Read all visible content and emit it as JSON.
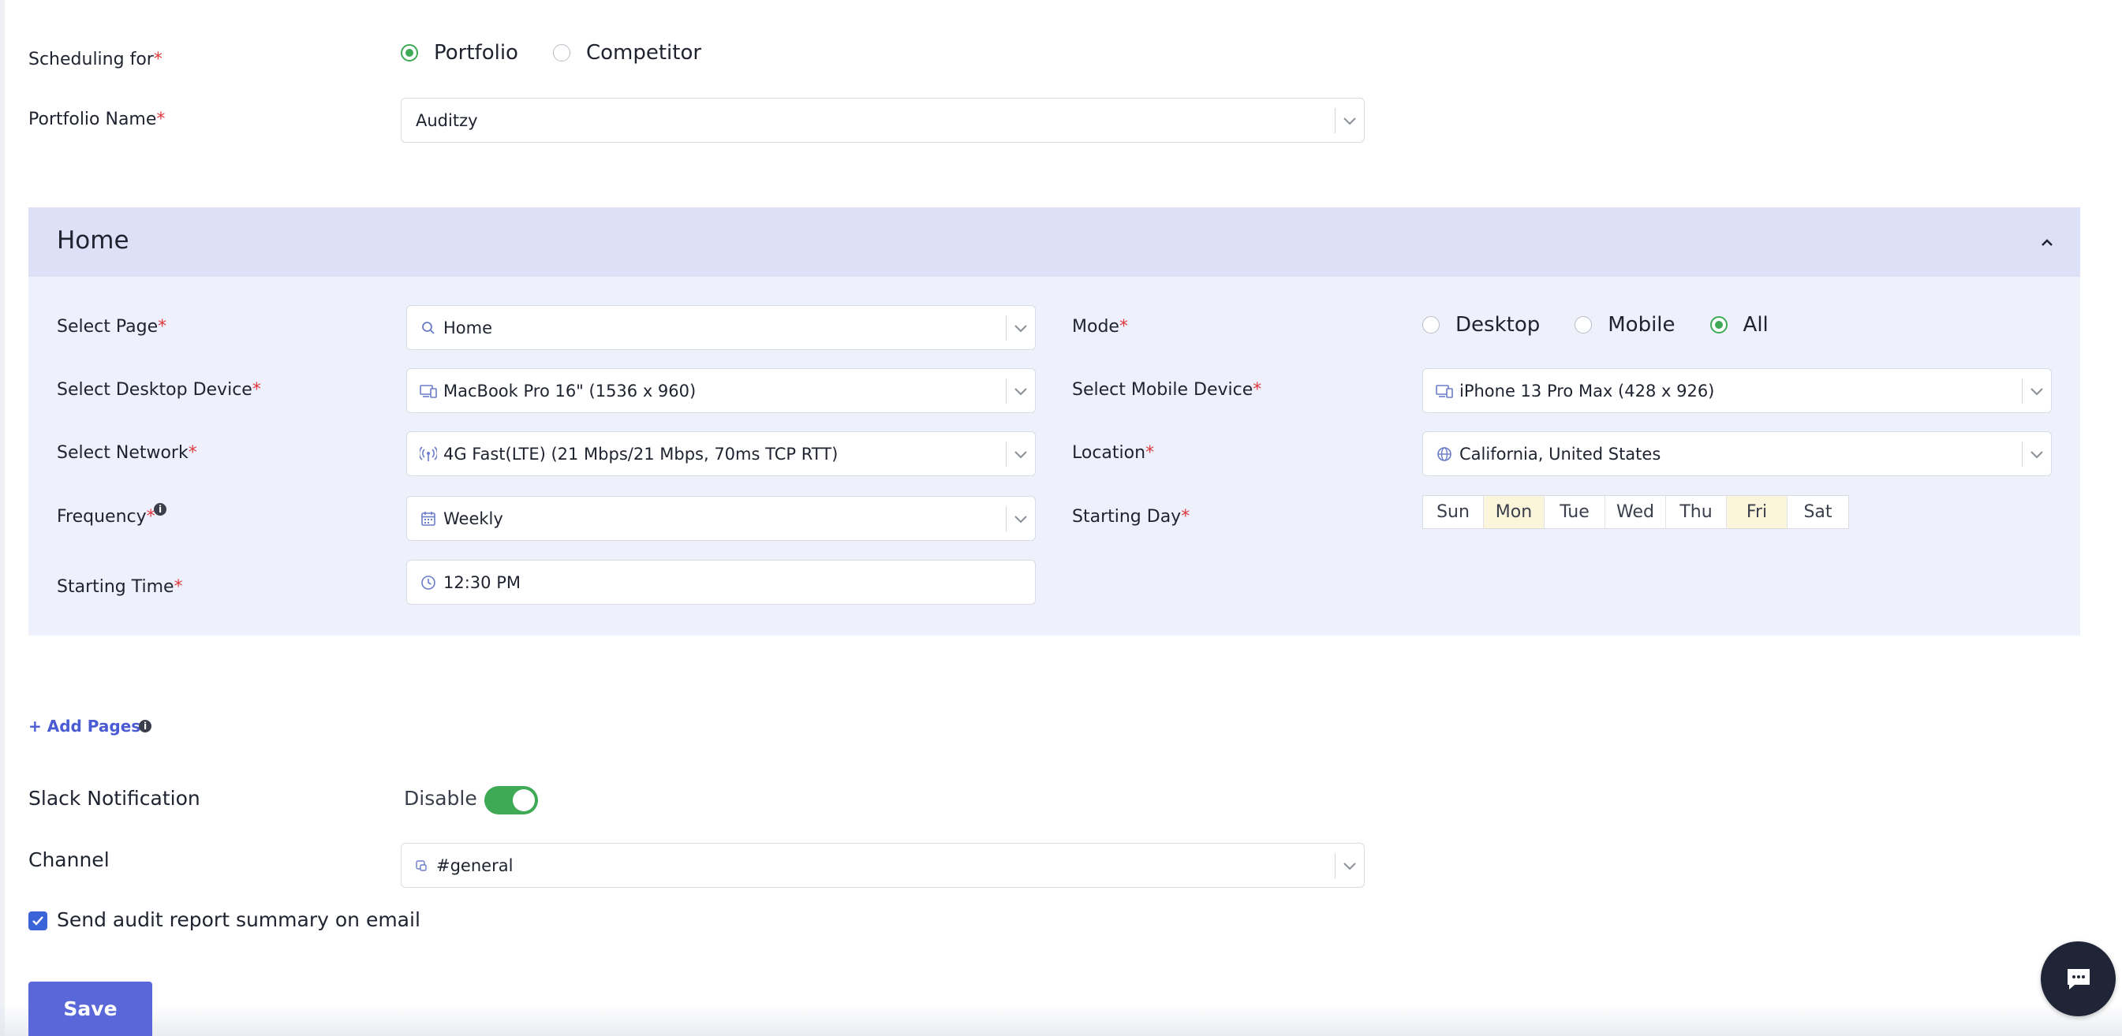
{
  "form": {
    "scheduling_for": {
      "label": "Scheduling for",
      "required_mark": "*",
      "options": [
        "Portfolio",
        "Competitor"
      ],
      "selected": "Portfolio"
    },
    "portfolio_name": {
      "label": "Portfolio Name",
      "required_mark": "*",
      "value": "Auditzy"
    }
  },
  "page_panel": {
    "title": "Home",
    "select_page": {
      "label": "Select Page",
      "required_mark": "*",
      "value": "Home",
      "icon": "search-icon"
    },
    "mode": {
      "label": "Mode",
      "required_mark": "*",
      "options": [
        "Desktop",
        "Mobile",
        "All"
      ],
      "selected": "All"
    },
    "desktop_device": {
      "label": "Select Desktop Device",
      "required_mark": "*",
      "value": "MacBook Pro 16\" (1536 x 960)",
      "icon": "device-icon"
    },
    "mobile_device": {
      "label": "Select Mobile Device",
      "required_mark": "*",
      "value": "iPhone 13 Pro Max (428 x 926)",
      "icon": "device-icon"
    },
    "network": {
      "label": "Select Network",
      "required_mark": "*",
      "value": "4G Fast(LTE) (21 Mbps/21 Mbps, 70ms TCP RTT)",
      "icon": "signal-icon"
    },
    "location": {
      "label": "Location",
      "required_mark": "*",
      "value": "California, United States",
      "icon": "globe-icon"
    },
    "frequency": {
      "label": "Frequency",
      "required_mark": "*",
      "value": "Weekly",
      "icon": "calendar-icon"
    },
    "starting_day": {
      "label": "Starting Day",
      "required_mark": "*",
      "days": [
        "Sun",
        "Mon",
        "Tue",
        "Wed",
        "Thu",
        "Fri",
        "Sat"
      ],
      "highlighted": [
        "Mon",
        "Fri"
      ]
    },
    "starting_time": {
      "label": "Starting Time",
      "required_mark": "*",
      "value": "12:30 PM",
      "icon": "clock-icon"
    }
  },
  "add_pages": {
    "label": "+ Add Pages"
  },
  "slack": {
    "label": "Slack Notification",
    "toggle_label": "Disable",
    "enabled": true,
    "channel_label": "Channel",
    "channel_value": "#general"
  },
  "email_summary": {
    "label": "Send audit report summary on email",
    "checked": true
  },
  "actions": {
    "save_label": "Save"
  },
  "colors": {
    "accent": "#5a67d8",
    "success": "#3eaa56",
    "required": "#e0393e",
    "panel_header": "#dde1f8",
    "panel_body": "#eef0fb",
    "day_highlight": "#fbf5dc"
  }
}
